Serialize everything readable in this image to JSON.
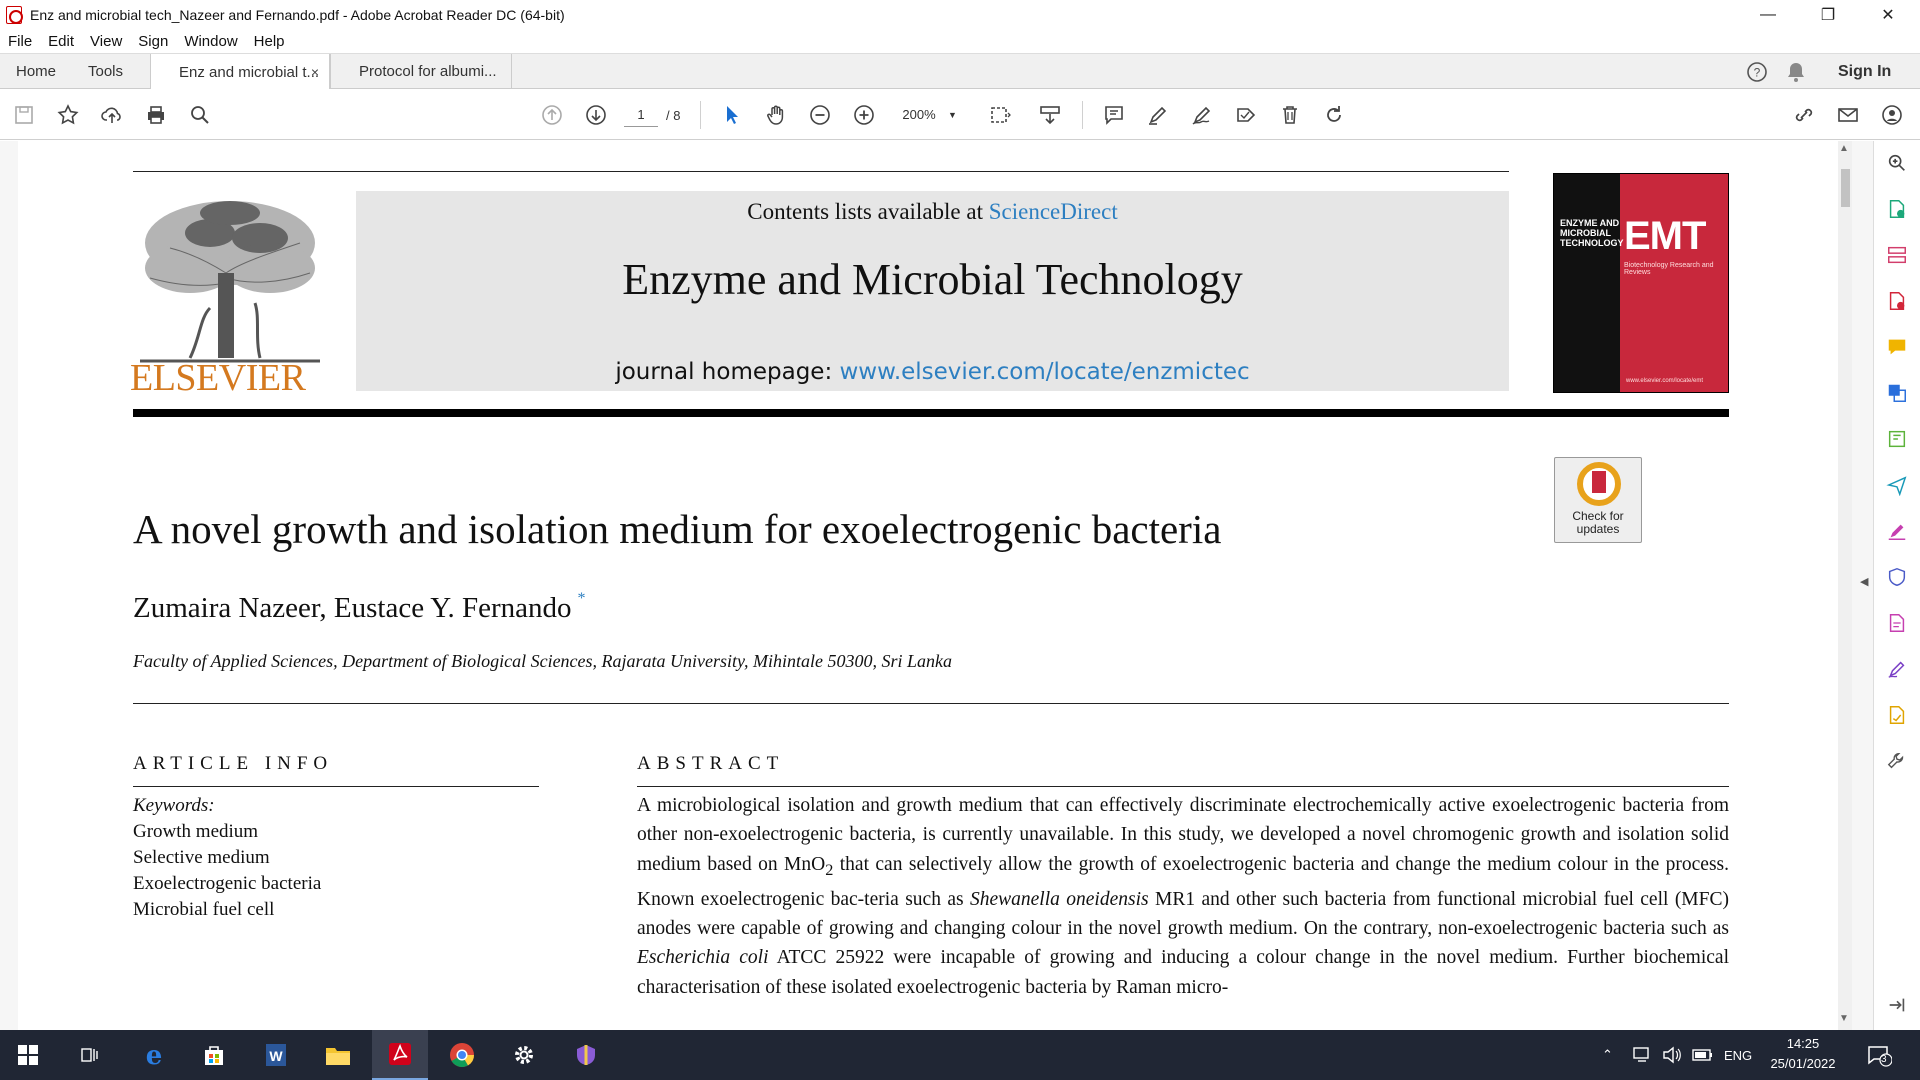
{
  "window": {
    "title": "Enz and microbial tech_Nazeer and Fernando.pdf - Adobe Acrobat Reader DC (64-bit)",
    "minimize": "—",
    "restore": "❐",
    "close": "✕"
  },
  "menu": [
    "File",
    "Edit",
    "View",
    "Sign",
    "Window",
    "Help"
  ],
  "tabs": {
    "home": "Home",
    "tools": "Tools",
    "doc1": "Enz and microbial t...",
    "doc1_close": "×",
    "doc2": "Protocol for albumi...",
    "sign_in": "Sign In"
  },
  "toolbar": {
    "page_current": "1",
    "page_total": "/ 8",
    "zoom": "200%"
  },
  "document": {
    "contents_prefix": "Contents lists available at ",
    "contents_link": "ScienceDirect",
    "journal": "Enzyme and Microbial Technology",
    "homepage_prefix": "journal homepage: ",
    "homepage_link": "www.elsevier.com/locate/enzmictec",
    "publisher": "ELSEVIER",
    "cover": {
      "label": "ENZYME AND MICROBIAL TECHNOLOGY",
      "abbr": "EMT",
      "subtitle": "Biotechnology Research and Reviews",
      "url": "www.elsevier.com/locate/emt"
    },
    "badge": "Check for updates",
    "title": "A novel growth and isolation medium for exoelectrogenic bacteria",
    "authors": "Zumaira Nazeer, Eustace Y. Fernando",
    "author_mark": "*",
    "affiliation": "Faculty of Applied Sciences, Department of Biological Sciences, Rajarata University, Mihintale 50300, Sri Lanka",
    "article_info_heading": "ARTICLE INFO",
    "abstract_heading": "ABSTRACT",
    "keywords_label": "Keywords:",
    "keywords": [
      "Growth medium",
      "Selective medium",
      "Exoelectrogenic bacteria",
      "Microbial fuel cell"
    ],
    "abstract": {
      "p1": "A microbiological isolation and growth medium that can effectively discriminate electrochemically active exoelectrogenic bacteria from other non-exoelectrogenic bacteria, is currently unavailable. In this study, we developed a novel chromogenic growth and isolation solid medium based on MnO",
      "sub": "2",
      "p2": " that can selectively allow the growth of exoelectrogenic bacteria and change the medium colour in the process. Known exoelectrogenic bac-teria such as ",
      "sp1": "Shewanella oneidensis",
      "p3": " MR1 and other such bacteria from functional microbial fuel cell (MFC) anodes were capable of growing and changing colour in the novel growth medium. On the contrary, non-exoelectrogenic bacteria such as ",
      "sp2": "Escherichia coli",
      "p4": " ATCC 25922 were incapable of growing and inducing a colour change in the novel medium. Further biochemical characterisation of these isolated exoelectrogenic bacteria by Raman micro-"
    }
  },
  "taskbar": {
    "lang": "ENG",
    "time": "14:25",
    "date": "25/01/2022",
    "notifications": "3"
  },
  "colors": {
    "accent_red": "#c8283c",
    "link_blue": "#2d7fc1",
    "elsevier_orange": "#d4791f",
    "taskbar": "#202634"
  }
}
